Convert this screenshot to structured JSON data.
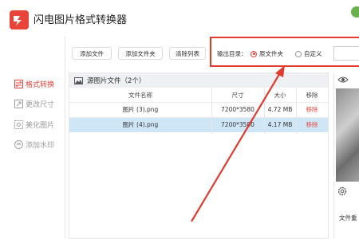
{
  "app": {
    "title": "闪电图片格式转换器"
  },
  "sidebar": {
    "items": [
      {
        "label": "格式转换",
        "icon": "convert-icon",
        "active": true
      },
      {
        "label": "更改尺寸",
        "icon": "resize-icon",
        "active": false
      },
      {
        "label": "美化图片",
        "icon": "beautify-icon",
        "active": false
      },
      {
        "label": "添加水印",
        "icon": "watermark-icon",
        "active": false
      }
    ]
  },
  "toolbar": {
    "add_file": "添加文件",
    "add_folder": "添加文件夹",
    "clear_list": "清除列表",
    "output_dir_label": "输出目录：",
    "option_source": "原文件夹",
    "option_custom": "自定义",
    "selected_option": "原文件夹"
  },
  "file_panel": {
    "title": "源图片文件（2个）",
    "columns": [
      "文件名称",
      "尺寸",
      "大小",
      "移除"
    ],
    "rows": [
      {
        "name": "图片 (3).png",
        "dimensions": "7200*3580",
        "size": "4.72 MB",
        "remove": "移除",
        "selected": false
      },
      {
        "name": "图片 (4).png",
        "dimensions": "7200*3580",
        "size": "4.17 MB",
        "remove": "移除",
        "selected": true
      }
    ]
  },
  "settings": {
    "label": "文件重"
  },
  "colors": {
    "accent": "#e8443a",
    "highlight_box": "#e23a2e",
    "selected_row": "#cfe6f7"
  }
}
